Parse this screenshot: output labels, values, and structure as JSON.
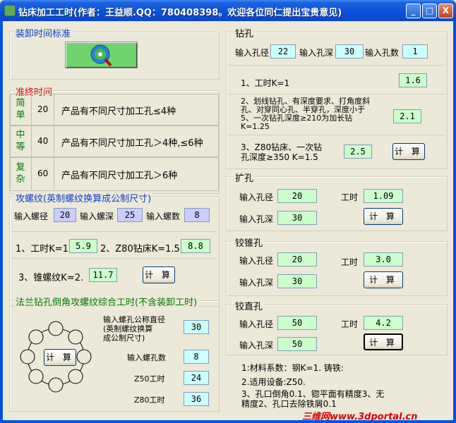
{
  "title": "钻床加工工时(作者：王益顺.QQ：780408398。欢迎各位同仁提出宝贵意见)",
  "window_buttons": {
    "minimize": "_",
    "maximize": "□",
    "close": "X"
  },
  "loading": {
    "title": "装卸时间标准"
  },
  "setup_time": {
    "title": "准终时间",
    "rows": [
      {
        "level": [
          "简",
          "单"
        ],
        "value": "20",
        "desc": "产品有不同尺寸加工孔≤4种"
      },
      {
        "level": [
          "中",
          "等"
        ],
        "value": "40",
        "desc": "产品有不同尺寸加工孔＞4种,≤6种"
      },
      {
        "level": [
          "复",
          "杂"
        ],
        "value": "60",
        "desc": "产品有不同尺寸加工孔＞6种"
      }
    ]
  },
  "tapping": {
    "title": "攻螺纹(英制螺纹换算成公制尺寸)",
    "dia_label": "输入螺径",
    "dia_value": "20",
    "depth_label": "输入螺深",
    "depth_value": "25",
    "count_label": "输入螺数",
    "count_value": "8",
    "k1_label": "1、工时K=1",
    "k1_value": "5.9",
    "k2_label": "2、Z80钻床K=1.5.",
    "k2_value": "8.8",
    "k3_label": "3、锥螺纹K=2.",
    "k3_value": "11.7",
    "calc": "计 算"
  },
  "flange": {
    "title": "法兰钻孔倒角攻螺纹综合工时(不含装卸工时)",
    "nominal_label": "输入螺孔公称直径\n(英制螺纹换算\n成公制尺寸)",
    "nominal_value": "30",
    "holes_label": "输入螺孔数",
    "holes_value": "8",
    "z50_label": "Z50工时",
    "z50_value": "24",
    "z80_label": "Z80工时",
    "z80_value": "36",
    "calc": "计 算"
  },
  "drilling": {
    "title": "钻孔",
    "dia_label": "输入孔径",
    "dia_value": "22",
    "depth_label": "输入孔深",
    "depth_value": "30",
    "count_label": "输入孔数",
    "count_value": "1",
    "k1_label": "1、工时K=1",
    "k1_value": "1.6",
    "k2_label": "2、划线钻孔、有深度要求、打角度斜\n孔、对穿同心孔、半穿孔，深度小于\n5、一次钻孔深度≥210为加长钻\nK=1.25",
    "k2_value": "2.1",
    "k3_label": "3、Z80钻床、一次钻\n孔深度≥350 K=1.5",
    "k3_value": "2.5",
    "calc": "计 算"
  },
  "reaming": {
    "title": "扩孔",
    "dia_label": "输入孔径",
    "dia_value": "20",
    "time_label": "工时",
    "time_value": "1.09",
    "depth_label": "输入孔深",
    "depth_value": "30",
    "calc": "计 算"
  },
  "taper_ream": {
    "title": "铰锥孔",
    "dia_label": "输入孔径",
    "dia_value": "20",
    "time_label": "工时",
    "time_value": "3.0",
    "depth_label": "输入孔深",
    "depth_value": "30",
    "calc": "计 算"
  },
  "straight_ream": {
    "title": "铰直孔",
    "dia_label": "输入孔径",
    "dia_value": "50",
    "time_label": "工时",
    "time_value": "4.2",
    "depth_label": "输入孔深",
    "depth_value": "50",
    "calc": "计 算"
  },
  "notes": {
    "n1": "1:材料系数：钢K=1. 铸铁:",
    "n2": "2.适用设备:Z50.",
    "n3": "3、孔口倒角0.1、锪平面有精度3、无\n精度2、孔口去除铁屑0.1"
  },
  "watermark": "三维网www.3dportal.cn",
  "colors": {
    "titlebar": "#0a4fd8",
    "label_blue": "#0a3fcf",
    "label_red": "#d01010",
    "label_green": "#007a00",
    "cyan_box": "#ccffff",
    "mint_box": "#ccffcc",
    "lavender_box": "#ccccff"
  }
}
